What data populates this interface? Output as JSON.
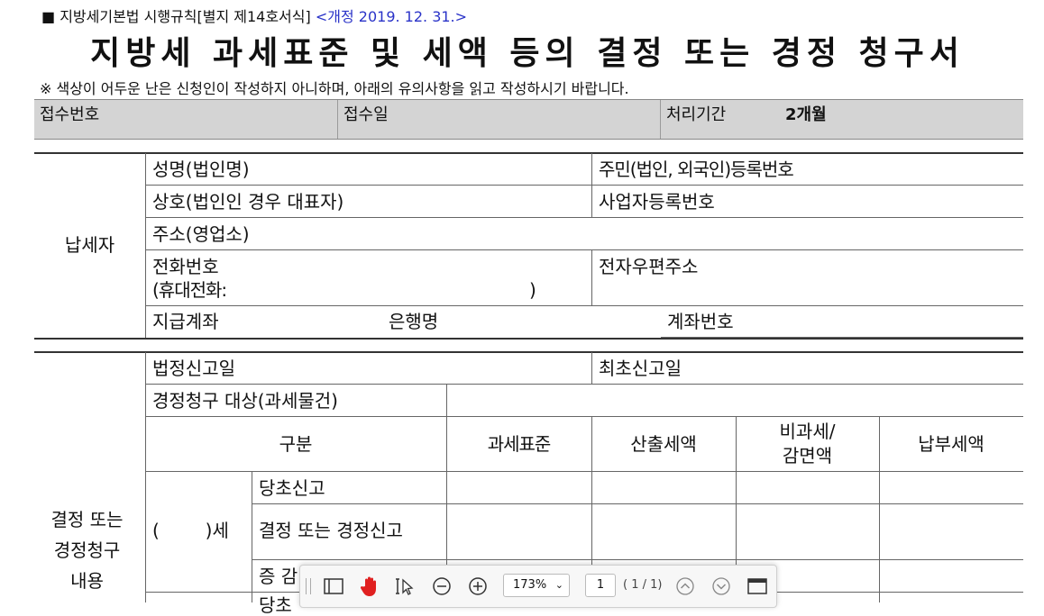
{
  "header": {
    "form_ref": "■ 지방세기본법 시행규칙[별지 제14호서식]",
    "revision": "<개정 2019. 12. 31.>",
    "title": "지방세 과세표준 및 세액 등의 결정 또는 경정 청구서",
    "note": "※ 색상이 어두운 난은 신청인이 작성하지 아니하며, 아래의 유의사항을 읽고 작성하시기 바랍니다."
  },
  "receipt": {
    "number_label": "접수번호",
    "date_label": "접수일",
    "period_label": "처리기간",
    "period_value": "2개월"
  },
  "taxpayer": {
    "section_label": "납세자",
    "name": "성명(법인명)",
    "reg_no": "주민(법인, 외국인)등록번호",
    "trade_name": "상호(법인인 경우 대표자)",
    "business_no": "사업자등록번호",
    "address": "주소(영업소)",
    "phone": "전화번호",
    "mobile": "(휴대전화:",
    "mobile_close": ")",
    "email": "전자우편주소",
    "account": "지급계좌",
    "bank": "은행명",
    "account_no": "계좌번호"
  },
  "claim": {
    "section_label_1": "결정 또는",
    "section_label_2": "경정청구",
    "section_label_3": "내용",
    "legal_date": "법정신고일",
    "first_date": "최초신고일",
    "target": "경정청구 대상(과세물건)",
    "col_division": "구분",
    "col_base": "과세표준",
    "col_calc": "산출세액",
    "col_exempt_1": "비과세/",
    "col_exempt_2": "감면액",
    "col_paid": "납부세액",
    "tax_type": "(        )세",
    "row_initial": "당초신고",
    "row_decision": "결정 또는 경정신고",
    "row_change": "증 감",
    "row_partial": "당초"
  },
  "viewer": {
    "zoom": "173%",
    "page": "1",
    "page_total": "( 1 / 1)"
  }
}
